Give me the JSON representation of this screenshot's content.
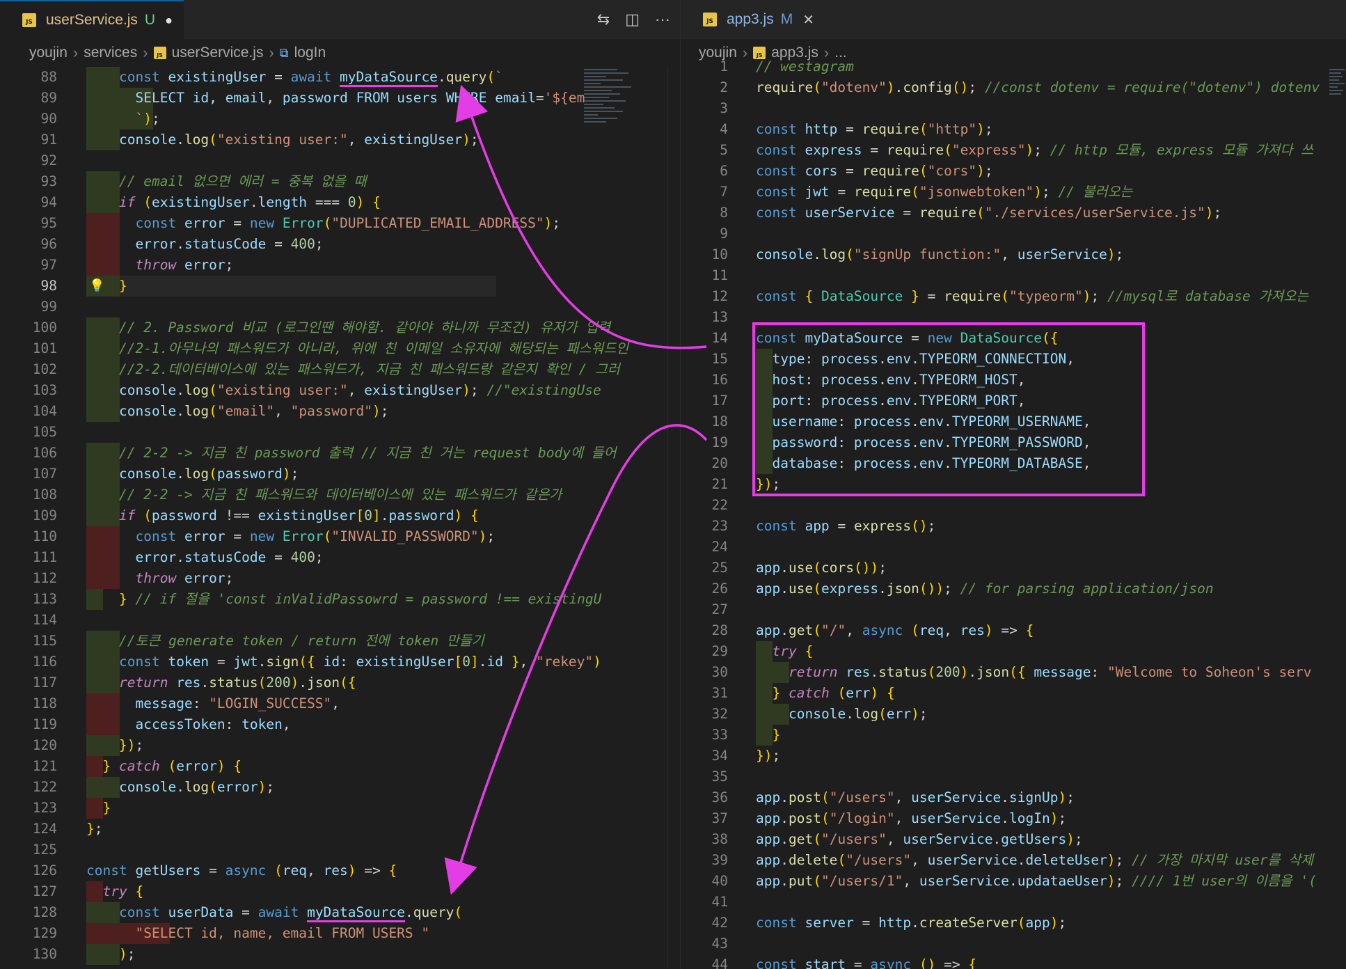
{
  "left": {
    "tab": {
      "icon": "JS",
      "filename": "userService.js",
      "status": "U"
    },
    "breadcrumb": [
      "youjin",
      "services",
      "userService.js",
      "logIn"
    ],
    "lines": [
      {
        "n": "88",
        "t": "    const existingUser = await myDataSource.query(`"
      },
      {
        "n": "89",
        "t": "      SELECT id, email, password FROM users WHERE email='${em"
      },
      {
        "n": "90",
        "t": "      `);"
      },
      {
        "n": "91",
        "t": "    console.log(\"existing user:\", existingUser);"
      },
      {
        "n": "92",
        "t": ""
      },
      {
        "n": "93",
        "t": "    // email 없으면 에러 = 중복 없을 때"
      },
      {
        "n": "94",
        "t": "    if (existingUser.length === 0) {"
      },
      {
        "n": "95",
        "t": "      const error = new Error(\"DUPLICATED_EMAIL_ADDRESS\");"
      },
      {
        "n": "96",
        "t": "      error.statusCode = 400;"
      },
      {
        "n": "97",
        "t": "      throw error;"
      },
      {
        "n": "98",
        "t": "    }"
      },
      {
        "n": "99",
        "t": ""
      },
      {
        "n": "100",
        "t": "    // 2. Password 비교 (로그인땐 해야함. 같아야 하니까 무조건) 유저가 입력"
      },
      {
        "n": "101",
        "t": "    //2-1.아무나의 패스워드가 아니라, 위에 친 이메일 소유자에 해당되는 패스워드인"
      },
      {
        "n": "102",
        "t": "    //2-2.데이터베이스에 있는 패스워드가, 지금 친 패스워드랑 같은지 확인 / 그러"
      },
      {
        "n": "103",
        "t": "    console.log(\"existing user:\", existingUser); //\"existingUse"
      },
      {
        "n": "104",
        "t": "    console.log(\"email\", \"password\");"
      },
      {
        "n": "105",
        "t": ""
      },
      {
        "n": "106",
        "t": "    // 2-2 -> 지금 친 password 출력 // 지금 친 거는 request body에 들어"
      },
      {
        "n": "107",
        "t": "    console.log(password);"
      },
      {
        "n": "108",
        "t": "    // 2-2 -> 지금 친 패스워드와 데이터베이스에 있는 패스워드가 같은가"
      },
      {
        "n": "109",
        "t": "    if (password !== existingUser[0].password) {"
      },
      {
        "n": "110",
        "t": "      const error = new Error(\"INVALID_PASSWORD\");"
      },
      {
        "n": "111",
        "t": "      error.statusCode = 400;"
      },
      {
        "n": "112",
        "t": "      throw error;"
      },
      {
        "n": "113",
        "t": "    } // if 절을 'const inValidPassowrd = password !== existingU"
      },
      {
        "n": "114",
        "t": ""
      },
      {
        "n": "115",
        "t": "    //토큰 generate token / return 전에 token 만들기"
      },
      {
        "n": "116",
        "t": "    const token = jwt.sign({ id: existingUser[0].id }, \"rekey\")"
      },
      {
        "n": "117",
        "t": "    return res.status(200).json({"
      },
      {
        "n": "118",
        "t": "      message: \"LOGIN_SUCCESS\","
      },
      {
        "n": "119",
        "t": "      accessToken: token,"
      },
      {
        "n": "120",
        "t": "    });"
      },
      {
        "n": "121",
        "t": "  } catch (error) {"
      },
      {
        "n": "122",
        "t": "    console.log(error);"
      },
      {
        "n": "123",
        "t": "  }"
      },
      {
        "n": "124",
        "t": "};"
      },
      {
        "n": "125",
        "t": ""
      },
      {
        "n": "126",
        "t": "const getUsers = async (req, res) => {"
      },
      {
        "n": "127",
        "t": "  try {"
      },
      {
        "n": "128",
        "t": "    const userData = await myDataSource.query("
      },
      {
        "n": "129",
        "t": "      \"SELECT id, name, email FROM USERS \""
      },
      {
        "n": "130",
        "t": "    );"
      }
    ]
  },
  "right": {
    "tab": {
      "icon": "JS",
      "filename": "app3.js",
      "status": "M"
    },
    "breadcrumb": [
      "youjin",
      "app3.js",
      "..."
    ],
    "lines": [
      {
        "n": "1",
        "t": "// westagram"
      },
      {
        "n": "2",
        "t": "require(\"dotenv\").config(); //const dotenv = require(\"dotenv\") dotenv"
      },
      {
        "n": "3",
        "t": ""
      },
      {
        "n": "4",
        "t": "const http = require(\"http\");"
      },
      {
        "n": "5",
        "t": "const express = require(\"express\"); // http 모듈, express 모듈 가져다 쓰"
      },
      {
        "n": "6",
        "t": "const cors = require(\"cors\");"
      },
      {
        "n": "7",
        "t": "const jwt = require(\"jsonwebtoken\"); // 불러오는"
      },
      {
        "n": "8",
        "t": "const userService = require(\"./services/userService.js\");"
      },
      {
        "n": "9",
        "t": ""
      },
      {
        "n": "10",
        "t": "console.log(\"signUp function:\", userService);"
      },
      {
        "n": "11",
        "t": ""
      },
      {
        "n": "12",
        "t": "const { DataSource } = require(\"typeorm\"); //mysql로 database 가져오는"
      },
      {
        "n": "13",
        "t": ""
      },
      {
        "n": "14",
        "t": "const myDataSource = new DataSource({"
      },
      {
        "n": "15",
        "t": "  type: process.env.TYPEORM_CONNECTION,"
      },
      {
        "n": "16",
        "t": "  host: process.env.TYPEORM_HOST,"
      },
      {
        "n": "17",
        "t": "  port: process.env.TYPEORM_PORT,"
      },
      {
        "n": "18",
        "t": "  username: process.env.TYPEORM_USERNAME,"
      },
      {
        "n": "19",
        "t": "  password: process.env.TYPEORM_PASSWORD,"
      },
      {
        "n": "20",
        "t": "  database: process.env.TYPEORM_DATABASE,"
      },
      {
        "n": "21",
        "t": "});"
      },
      {
        "n": "22",
        "t": ""
      },
      {
        "n": "23",
        "t": "const app = express();"
      },
      {
        "n": "24",
        "t": ""
      },
      {
        "n": "25",
        "t": "app.use(cors());"
      },
      {
        "n": "26",
        "t": "app.use(express.json()); // for parsing application/json"
      },
      {
        "n": "27",
        "t": ""
      },
      {
        "n": "28",
        "t": "app.get(\"/\", async (req, res) => {"
      },
      {
        "n": "29",
        "t": "  try {"
      },
      {
        "n": "30",
        "t": "    return res.status(200).json({ message: \"Welcome to Soheon's serv"
      },
      {
        "n": "31",
        "t": "  } catch (err) {"
      },
      {
        "n": "32",
        "t": "    console.log(err);"
      },
      {
        "n": "33",
        "t": "  }"
      },
      {
        "n": "34",
        "t": "});"
      },
      {
        "n": "35",
        "t": ""
      },
      {
        "n": "36",
        "t": "app.post(\"/users\", userService.signUp);"
      },
      {
        "n": "37",
        "t": "app.post(\"/login\", userService.logIn);"
      },
      {
        "n": "38",
        "t": "app.get(\"/users\", userService.getUsers);"
      },
      {
        "n": "39",
        "t": "app.delete(\"/users\", userService.deleteUser); // 가장 마지막 user를 삭제"
      },
      {
        "n": "40",
        "t": "app.put(\"/users/1\", userService.updataeUser); //// 1번 user의 이름을 '("
      },
      {
        "n": "41",
        "t": ""
      },
      {
        "n": "42",
        "t": "const server = http.createServer(app);"
      },
      {
        "n": "43",
        "t": ""
      },
      {
        "n": "44",
        "t": "const start = async () => {"
      }
    ]
  },
  "icons": [
    "compare-changes-icon",
    "split-editor-icon",
    "more-actions-icon",
    "close-icon",
    "lightbulb-icon",
    "symbol-method-icon"
  ],
  "colors": {
    "annotation": "#e53de5",
    "background": "#1e1e1e",
    "tab_bar": "#252526"
  }
}
